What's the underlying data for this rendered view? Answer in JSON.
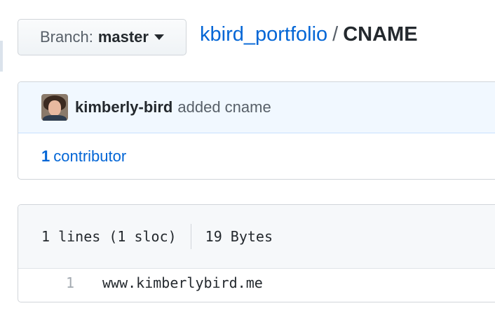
{
  "branch": {
    "prefix": "Branch:",
    "name": "master"
  },
  "breadcrumb": {
    "repo": "kbird_portfolio",
    "separator": "/",
    "file": "CNAME"
  },
  "commit": {
    "author": "kimberly-bird",
    "message": "added cname"
  },
  "contributors": {
    "count": "1",
    "label": "contributor"
  },
  "file_info": {
    "lines": "1 lines (1 sloc)",
    "size": "19 Bytes"
  },
  "code": {
    "lines": [
      {
        "number": "1",
        "text": "www.kimberlybird.me"
      }
    ]
  },
  "colors": {
    "link": "#0366d6",
    "tease_bg": "#f1f8ff",
    "header_bg": "#f6f8fa"
  }
}
